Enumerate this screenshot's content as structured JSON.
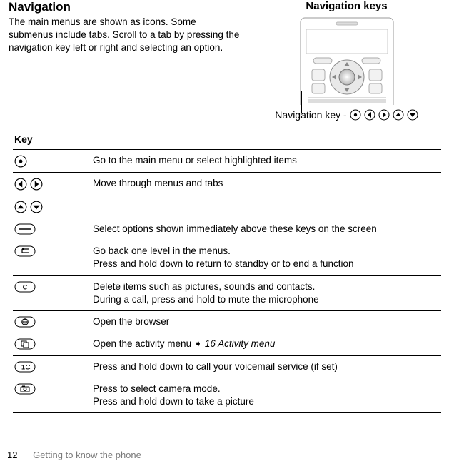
{
  "heading": "Navigation",
  "paragraph": "The main menus are shown as icons. Some submenus include tabs. Scroll to a tab by pressing the navigation key left or right and selecting an option.",
  "navKeysTitle": "Navigation keys",
  "captionPrefix": "Navigation key -",
  "keyHeader": "Key",
  "keys": {
    "r1": "Go to the main menu or select highlighted items",
    "r2": "Move through menus and tabs",
    "r3": "Select options shown immediately above these keys on the screen",
    "r4a": "Go back one level in the menus.",
    "r4b": "Press and hold down to return to standby or to end a function",
    "r5a": "Delete items such as pictures, sounds and contacts.",
    "r5b": "During a call, press and hold to mute the microphone",
    "r6": "Open the browser",
    "r7a": "Open the activity menu ",
    "r7arrow": "➧",
    "r7b": " 16 Activity menu",
    "r8": "Press and hold down to call your voicemail service (if set)",
    "r9a": "Press to select camera mode.",
    "r9b": "Press and hold down to take a picture"
  },
  "footer": {
    "page": "12",
    "chapter": "Getting to know the phone"
  }
}
